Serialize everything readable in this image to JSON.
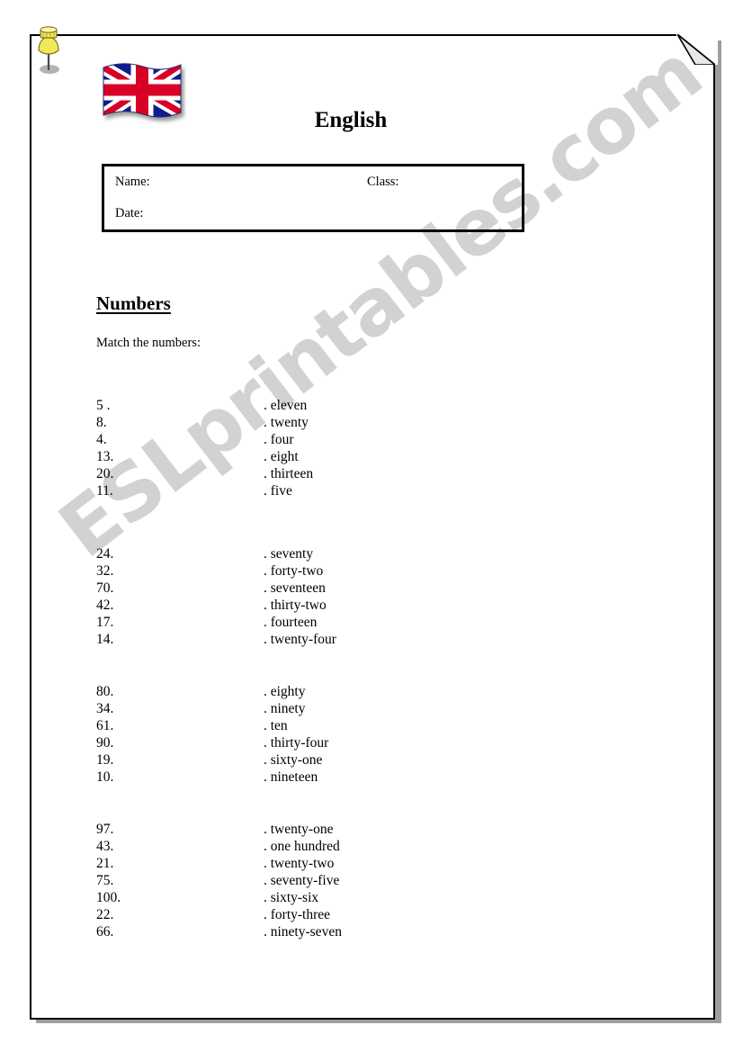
{
  "page": {
    "title": "English",
    "flag_icon": "union-jack-flag-icon",
    "pushpin_icon": "yellow-pushpin-icon",
    "dogear_icon": "folded-corner-icon",
    "watermark": "ESLprintables.com",
    "colors": {
      "ink": "#000000",
      "paper": "#ffffff",
      "page_shadow": "#9e9e9e",
      "watermark": "#d2d2d2",
      "flag_red": "#d80027",
      "flag_blue": "#0b1f8f",
      "flag_white": "#ffffff",
      "pushpin_yellow": "#f2e85c",
      "dogear_fill": "#e8e8e8"
    }
  },
  "info_box": {
    "name_label": "Name:",
    "class_label": "Class:",
    "date_label": "Date:"
  },
  "section": {
    "heading": "Numbers",
    "instruction": "Match the numbers:"
  },
  "exercise": {
    "type": "matching",
    "blocks": [
      {
        "rows": [
          {
            "left": "5 .",
            "right": ". eleven"
          },
          {
            "left": "8.",
            "right": ". twenty"
          },
          {
            "left": "4.",
            "right": ". four"
          },
          {
            "left": "13.",
            "right": ". eight"
          },
          {
            "left": "20.",
            "right": ". thirteen"
          },
          {
            "left": "11.",
            "right": ". five"
          }
        ]
      },
      {
        "rows": [
          {
            "left": "24.",
            "right": ". seventy"
          },
          {
            "left": "32.",
            "right": ". forty-two"
          },
          {
            "left": "70.",
            "right": ". seventeen"
          },
          {
            "left": "42.",
            "right": ". thirty-two"
          },
          {
            "left": "17.",
            "right": ". fourteen"
          },
          {
            "left": "14.",
            "right": ". twenty-four"
          }
        ]
      },
      {
        "rows": [
          {
            "left": "80.",
            "right": ". eighty"
          },
          {
            "left": "34.",
            "right": ". ninety"
          },
          {
            "left": "61.",
            "right": ". ten"
          },
          {
            "left": "90.",
            "right": ". thirty-four"
          },
          {
            "left": "19.",
            "right": ". sixty-one"
          },
          {
            "left": "10.",
            "right": ". nineteen"
          }
        ]
      },
      {
        "rows": [
          {
            "left": "97.",
            "right": ". twenty-one"
          },
          {
            "left": "43.",
            "right": ". one hundred"
          },
          {
            "left": "21.",
            "right": ". twenty-two"
          },
          {
            "left": "75.",
            "right": ". seventy-five"
          },
          {
            "left": "100.",
            "right": ". sixty-six"
          },
          {
            "left": "22.",
            "right": ". forty-three"
          },
          {
            "left": "66.",
            "right": ". ninety-seven"
          }
        ]
      }
    ]
  }
}
